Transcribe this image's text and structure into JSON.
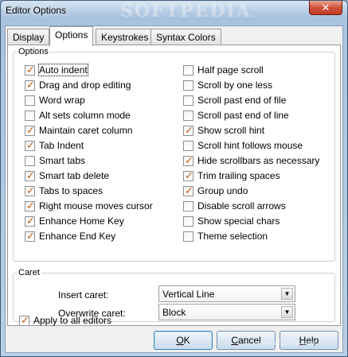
{
  "window": {
    "title": "Editor Options",
    "watermark": "SOFTPEDIA",
    "close_glyph": "✕"
  },
  "tabs": [
    {
      "label": "Display",
      "active": false
    },
    {
      "label": "Options",
      "active": true
    },
    {
      "label": "Keystrokes",
      "active": false
    },
    {
      "label": "Syntax Colors",
      "active": false
    }
  ],
  "options": {
    "legend": "Options",
    "left": [
      {
        "label": "Auto indent",
        "checked": true
      },
      {
        "label": "Drag and drop editing",
        "checked": true
      },
      {
        "label": "Word wrap",
        "checked": false
      },
      {
        "label": "Alt sets column mode",
        "checked": false
      },
      {
        "label": "Maintain caret column",
        "checked": true
      },
      {
        "label": "Tab Indent",
        "checked": true
      },
      {
        "label": "Smart tabs",
        "checked": false
      },
      {
        "label": "Smart tab delete",
        "checked": true
      },
      {
        "label": "Tabs to spaces",
        "checked": true
      },
      {
        "label": "Right mouse moves cursor",
        "checked": true
      },
      {
        "label": "Enhance Home Key",
        "checked": true
      },
      {
        "label": "Enhance End Key",
        "checked": true
      }
    ],
    "right": [
      {
        "label": "Half page scroll",
        "checked": false
      },
      {
        "label": "Scroll by one less",
        "checked": false
      },
      {
        "label": "Scroll past end of file",
        "checked": false
      },
      {
        "label": "Scroll past end of line",
        "checked": false
      },
      {
        "label": "Show scroll hint",
        "checked": true
      },
      {
        "label": "Scroll hint follows mouse",
        "checked": false
      },
      {
        "label": "Hide scrollbars as necessary",
        "checked": true
      },
      {
        "label": "Trim trailing spaces",
        "checked": true
      },
      {
        "label": "Group undo",
        "checked": true
      },
      {
        "label": "Disable scroll arrows",
        "checked": false
      },
      {
        "label": "Show special chars",
        "checked": false
      },
      {
        "label": "Theme selection",
        "checked": false
      }
    ]
  },
  "caret": {
    "legend": "Caret",
    "insert_label": "Insert caret:",
    "insert_value": "Vertical Line",
    "overwrite_label": "Overwrite caret:",
    "overwrite_value": "Block"
  },
  "apply_all": {
    "label": "Apply to all editors",
    "checked": true
  },
  "buttons": {
    "ok": {
      "mnemonic": "O",
      "rest": "K"
    },
    "cancel": {
      "mnemonic": "C",
      "rest": "ancel"
    },
    "help": {
      "mnemonic": "H",
      "rest": "elp"
    }
  },
  "footer_watermark": "www.softpedia.com"
}
